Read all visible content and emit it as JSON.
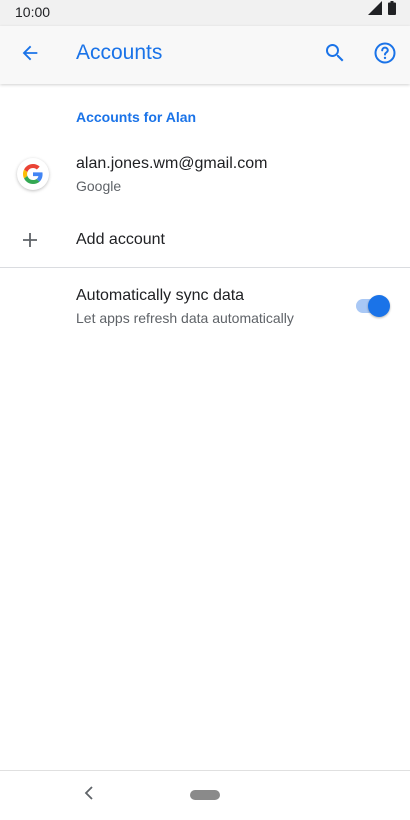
{
  "status_bar": {
    "time": "10:00",
    "icons": [
      "signal-icon",
      "battery-icon"
    ]
  },
  "app_bar": {
    "title": "Accounts",
    "back_icon": "arrow-back-icon",
    "actions": [
      "search-icon",
      "help-icon"
    ]
  },
  "accounts_section": {
    "header": "Accounts for Alan",
    "accounts": [
      {
        "email": "alan.jones.wm@gmail.com",
        "provider": "Google",
        "icon": "google-g-icon"
      }
    ],
    "add_account": {
      "label": "Add account",
      "icon": "plus-icon"
    }
  },
  "sync": {
    "title": "Automatically sync data",
    "summary": "Let apps refresh data automatically",
    "enabled": true
  },
  "nav_bar": {
    "back_icon": "nav-back-icon",
    "home_icon": "nav-home-pill-icon"
  },
  "colors": {
    "accent": "#1a73e8",
    "toggle_track": "#a9c8f5",
    "text_primary": "#202124",
    "text_secondary": "#5f6368",
    "status_bar_bg": "#f1f1f1",
    "app_bar_bg": "#f8f8f8"
  }
}
